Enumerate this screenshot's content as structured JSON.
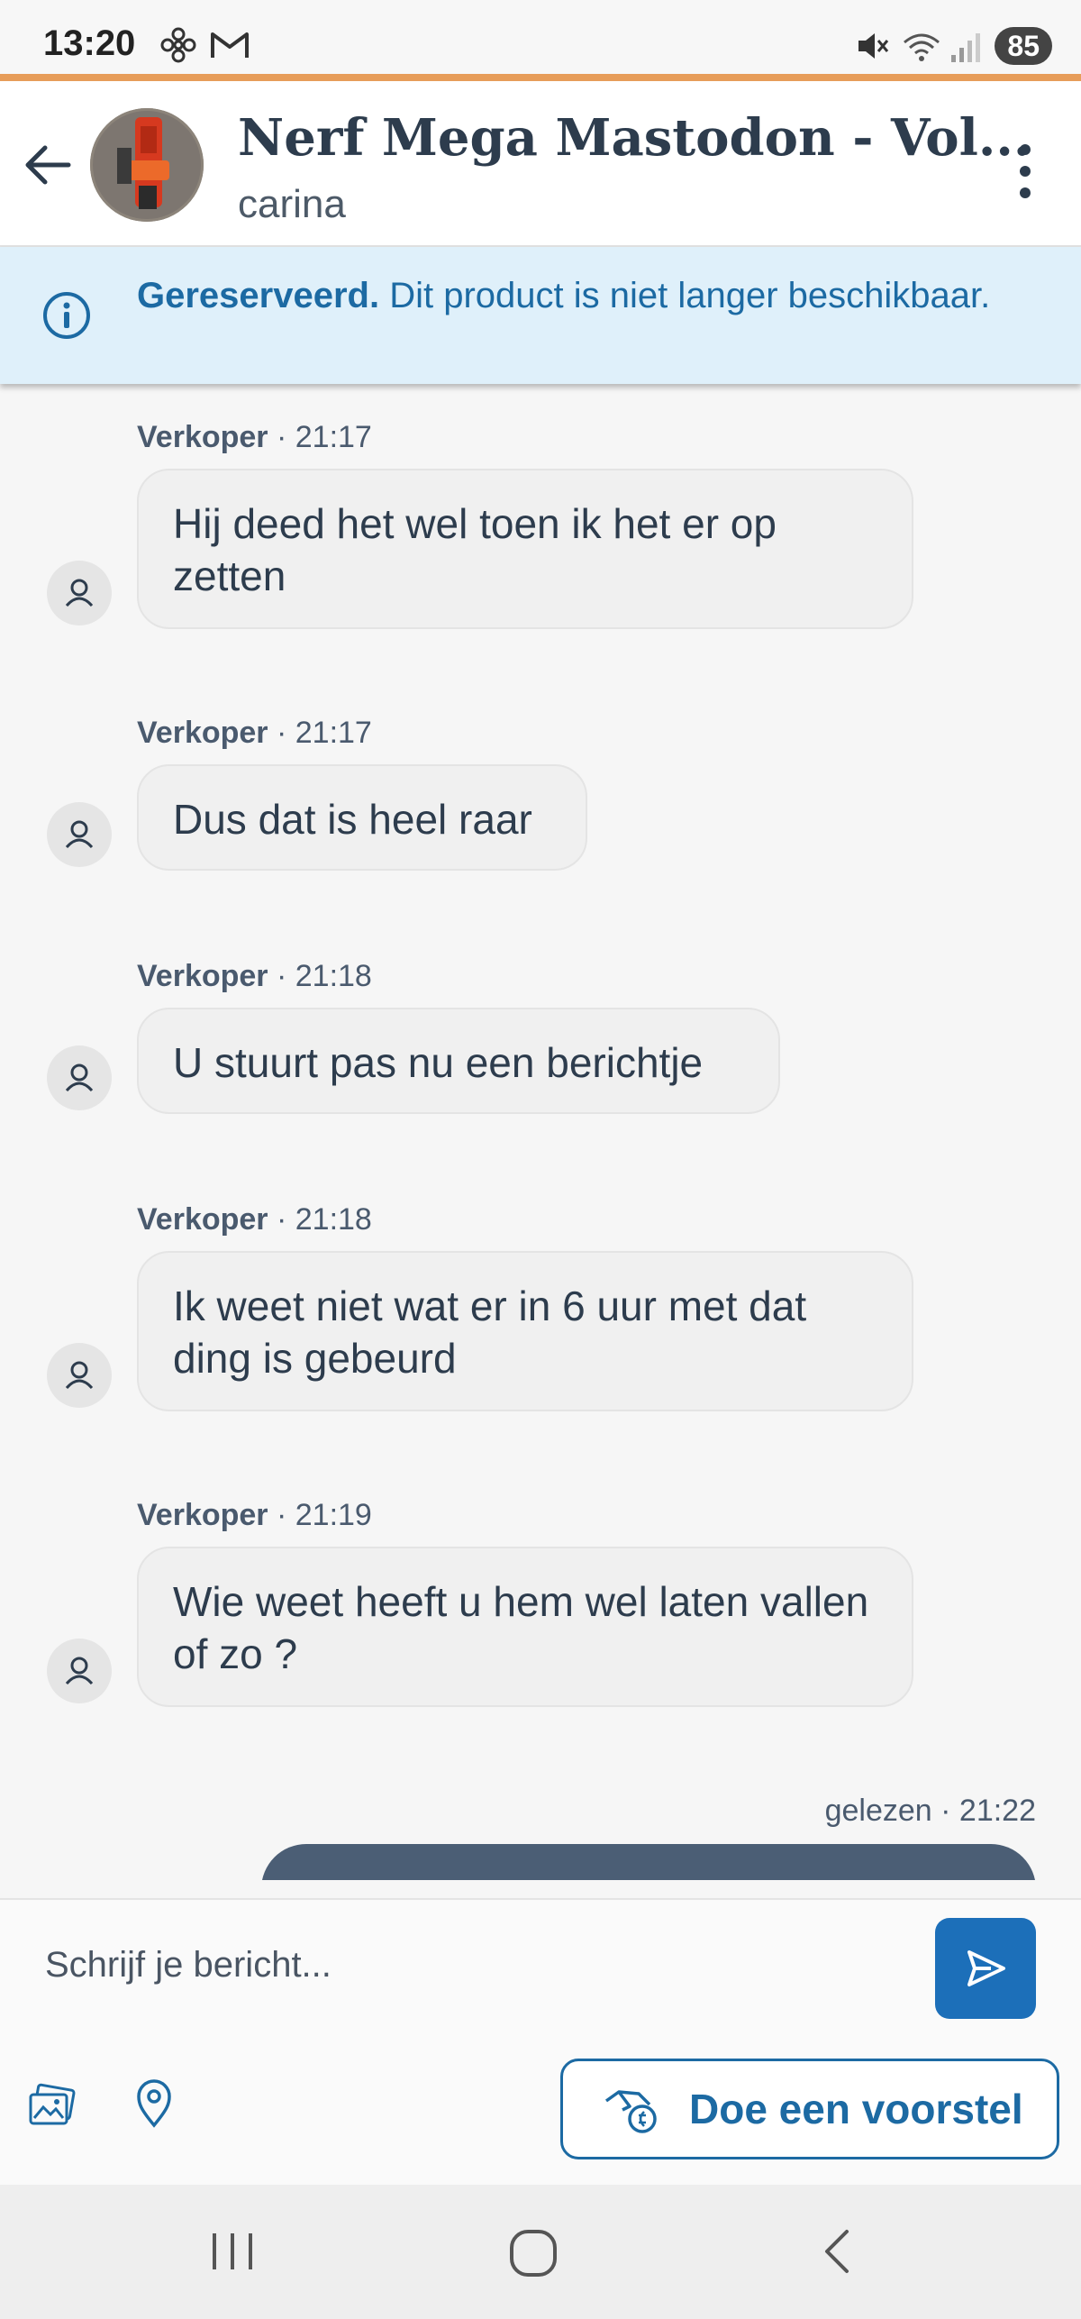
{
  "status_bar": {
    "time": "13:20",
    "left_icons": [
      "fan-icon",
      "gmail-icon"
    ],
    "right_icons": [
      "mute-icon",
      "wifi-icon",
      "signal-icon"
    ],
    "battery": "85"
  },
  "header": {
    "title": "Nerf Mega Mastodon - Vol...",
    "subtitle": "carina",
    "back_icon": "arrow-left-icon",
    "menu_icon": "more-vertical-icon"
  },
  "banner": {
    "status": "Gereserveerd.",
    "message": " Dit product is niet langer beschikbaar.",
    "icon": "info-icon"
  },
  "messages": [
    {
      "sender": "Verkoper",
      "time": "21:17",
      "text": "Hij deed het wel toen ik het er op zetten"
    },
    {
      "sender": "Verkoper",
      "time": "21:17",
      "text": "Dus dat is heel raar"
    },
    {
      "sender": "Verkoper",
      "time": "21:18",
      "text": "U stuurt pas nu een berichtje"
    },
    {
      "sender": "Verkoper",
      "time": "21:18",
      "text": "Ik weet niet wat er in 6 uur met dat ding is gebeurd"
    },
    {
      "sender": "Verkoper",
      "time": "21:19",
      "text": "Wie weet heeft u hem wel laten vallen of zo ?"
    }
  ],
  "own_message": {
    "status": "gelezen",
    "time": "21:22"
  },
  "composer": {
    "placeholder": "Schrijf je bericht..."
  },
  "actions": {
    "gallery_icon": "image-icon",
    "location_icon": "location-pin-icon",
    "offer_label": "Doe een voorstel",
    "offer_icon": "hand-coin-icon"
  },
  "colors": {
    "accent_line": "#e79d59",
    "brand_blue": "#1c6aa3",
    "banner_bg": "#dff0fa",
    "own_bubble": "#4b5e75"
  }
}
